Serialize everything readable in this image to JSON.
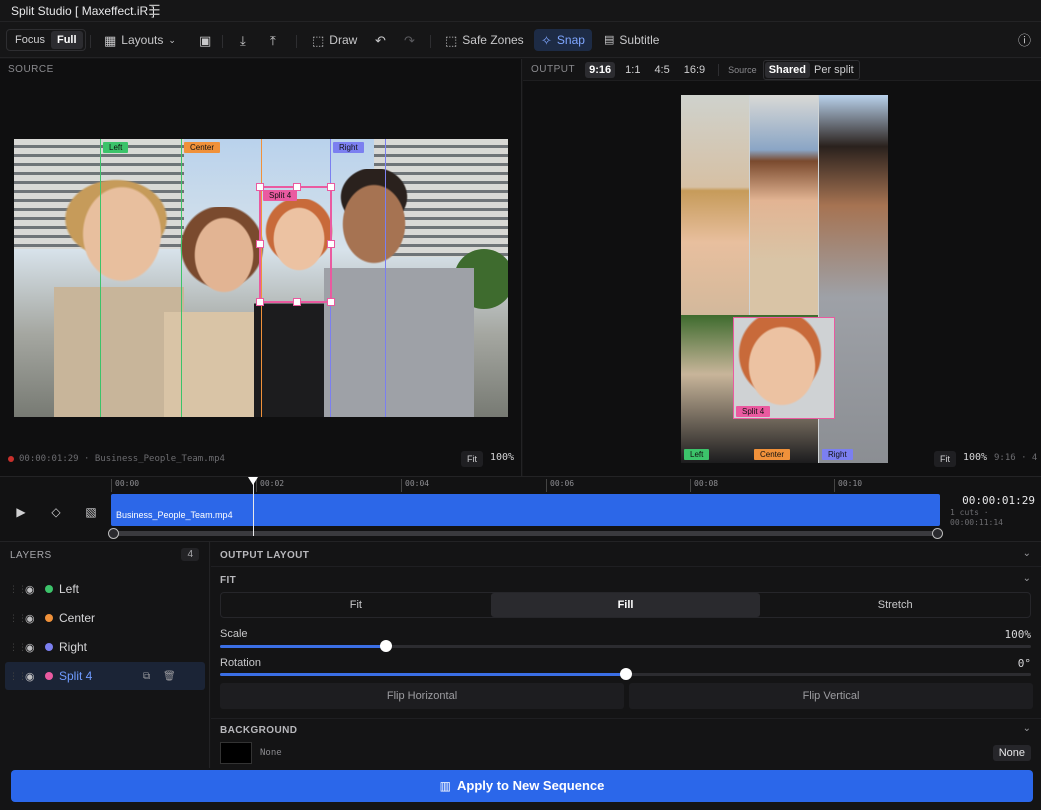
{
  "app": {
    "title": "Split Studio [ Maxeffect.iR ]"
  },
  "toolbar": {
    "focus_label": "Focus",
    "full_label": "Full",
    "layouts_label": "Layouts",
    "draw_label": "Draw",
    "safe_zones_label": "Safe Zones",
    "snap_label": "Snap",
    "subtitle_label": "Subtitle"
  },
  "source": {
    "label": "SOURCE",
    "zones": [
      "Left",
      "Center",
      "Right"
    ],
    "split_label": "Split 4",
    "timecode": "00:00:01:29 · Business_People_Team.mp4",
    "fit_label": "Fit",
    "zoom": "100%"
  },
  "output": {
    "label": "OUTPUT",
    "ratios": [
      "9:16",
      "1:1",
      "4:5",
      "16:9"
    ],
    "selected_ratio": "9:16",
    "source_label": "Source",
    "modes": [
      "Shared",
      "Per split"
    ],
    "selected_mode": "Shared",
    "tags": [
      "Split 4",
      "Left",
      "Center",
      "Right"
    ],
    "fit_label": "Fit",
    "zoom": "100%",
    "ratio_readout": "9:16 · 4"
  },
  "timeline": {
    "ticks": [
      "00:00",
      "00:02",
      "00:04",
      "00:06",
      "00:08",
      "00:10"
    ],
    "clip_name": "Business_People_Team.mp4",
    "timecode": "00:00:01:29",
    "cuts": "1 cuts · 00:00:11:14"
  },
  "layers": {
    "title": "LAYERS",
    "count": "4",
    "items": [
      {
        "name": "Left",
        "color": "#3cc36a"
      },
      {
        "name": "Center",
        "color": "#f0913a"
      },
      {
        "name": "Right",
        "color": "#7b7ff0"
      },
      {
        "name": "Split 4",
        "color": "#ea5aa0"
      }
    ]
  },
  "props": {
    "output_layout": "OUTPUT LAYOUT",
    "fit_section": "FIT",
    "fit_modes": [
      "Fit",
      "Fill",
      "Stretch"
    ],
    "selected_fit": "Fill",
    "scale_label": "Scale",
    "scale_value": "100%",
    "scale_fraction": 0.205,
    "rotation_label": "Rotation",
    "rotation_value": "0°",
    "rotation_fraction": 0.5,
    "flip_h": "Flip Horizontal",
    "flip_v": "Flip Vertical",
    "background_section": "BACKGROUND",
    "bg_value": "None",
    "bg_none_button": "None",
    "bg_color": "#000000"
  },
  "footer": {
    "apply_label": "Apply to New Sequence"
  }
}
